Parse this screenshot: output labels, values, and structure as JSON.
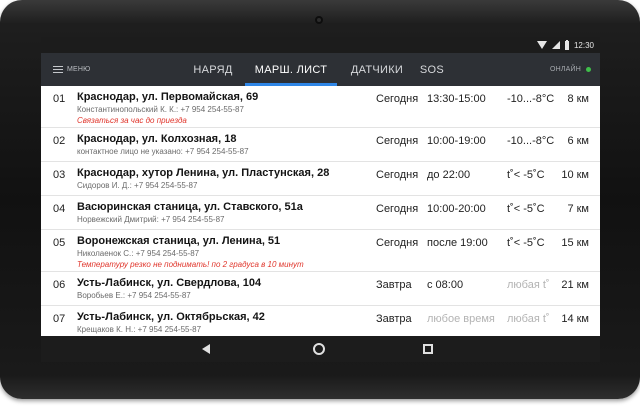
{
  "statusbar": {
    "time": "12:30"
  },
  "appbar": {
    "menu_label": "МЕНЮ",
    "tabs": [
      "НАРЯД",
      "МАРШ. ЛИСТ",
      "ДАТЧИКИ",
      "SOS"
    ],
    "active_tab": 1,
    "online_label": "ОНЛАЙН",
    "online_color": "#3fbf4a",
    "accent_color": "#2f86e6"
  },
  "routes": [
    {
      "num": "01",
      "address": "Краснодар, ул. Первомайская, 69",
      "contact": "Константинопольский К. К.: +7 954 254-55-87",
      "note": "Связаться за час до приезда",
      "day": "Сегодня",
      "time": "13:30-15:00",
      "temp": "-10...-8°C",
      "distance": "8 км"
    },
    {
      "num": "02",
      "address": "Краснодар, ул. Колхозная, 18",
      "contact": "контактное лицо не указано: +7 954 254-55-87",
      "note": "",
      "day": "Сегодня",
      "time": "10:00-19:00",
      "temp": "-10...-8°C",
      "distance": "6 км"
    },
    {
      "num": "03",
      "address": "Краснодар, хутор Ленина, ул. Пластунская, 28",
      "contact": "Сидоров И. Д.: +7 954 254-55-87",
      "note": "",
      "day": "Сегодня",
      "time": "до 22:00",
      "temp": "t˚< -5˚C",
      "distance": "10 км"
    },
    {
      "num": "04",
      "address": "Васюринская станица, ул. Ставского, 51а",
      "contact": "Норвежский Дмитрий: +7 954 254-55-87",
      "note": "",
      "day": "Сегодня",
      "time": "10:00-20:00",
      "temp": "t˚< -5˚C",
      "distance": "7 км"
    },
    {
      "num": "05",
      "address": "Воронежская станица, ул. Ленина, 51",
      "contact": "Николаенок С.: +7 954 254-55-87",
      "note": "Температуру резко не поднимать! по 2 градуса в 10 минут",
      "day": "Сегодня",
      "time": "после 19:00",
      "temp": "t˚< -5˚C",
      "distance": "15 км"
    },
    {
      "num": "06",
      "address": "Усть-Лабинск, ул. Свердлова, 104",
      "contact": "Воробьев Е.: +7 954 254-55-87",
      "note": "",
      "day": "Завтра",
      "time": "с 08:00",
      "temp": "любая t˚",
      "distance": "21 км"
    },
    {
      "num": "07",
      "address": "Усть-Лабинск, ул. Октябрьская, 42",
      "contact": "Крещаков К. Н.: +7 954 254-55-87",
      "note": "",
      "day": "Завтра",
      "time": "любое время",
      "temp": "любая t˚",
      "distance": "14 км"
    }
  ]
}
